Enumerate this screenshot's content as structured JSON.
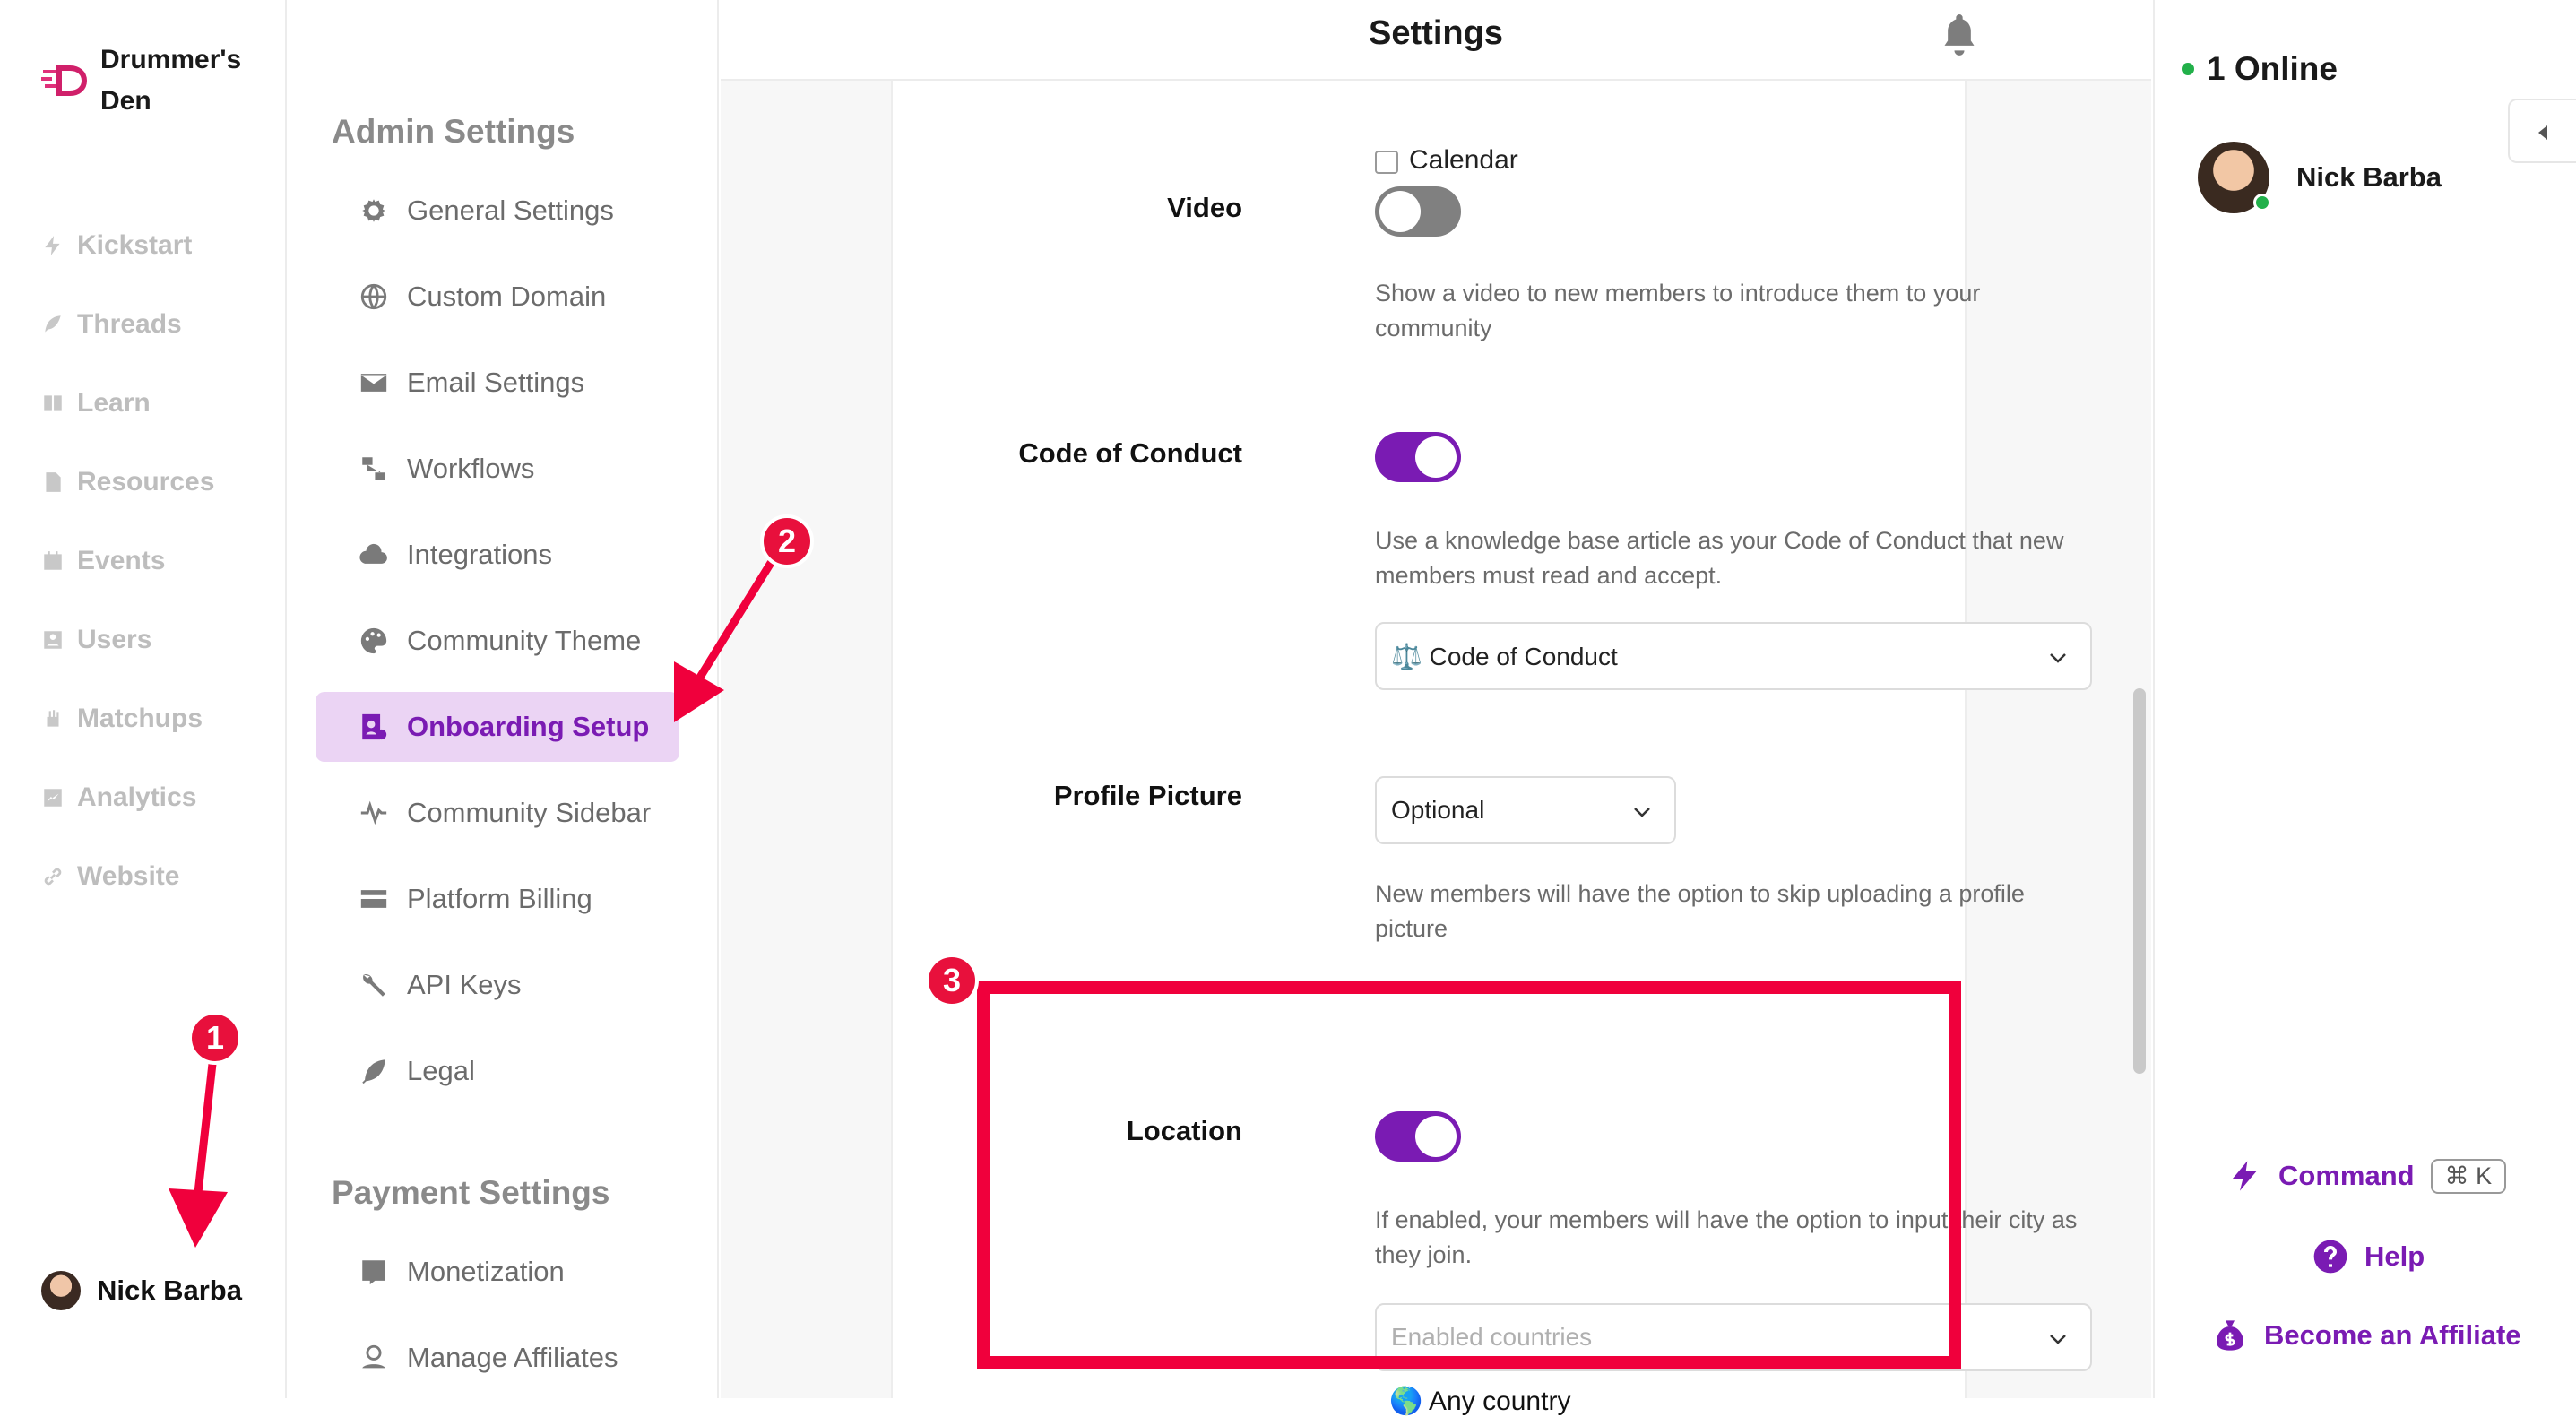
{
  "brand": {
    "name": "Drummer's Den"
  },
  "left_nav": {
    "items": [
      "Kickstart",
      "Threads",
      "Learn",
      "Resources",
      "Events",
      "Users",
      "Matchups",
      "Analytics",
      "Website"
    ],
    "user": "Nick Barba"
  },
  "settings_nav": {
    "admin_title": "Admin Settings",
    "admin_items": [
      "General Settings",
      "Custom Domain",
      "Email Settings",
      "Workflows",
      "Integrations",
      "Community Theme",
      "Onboarding Setup",
      "Community Sidebar",
      "Platform Billing",
      "API Keys",
      "Legal"
    ],
    "active_item": "Onboarding Setup",
    "payment_title": "Payment Settings",
    "payment_items": [
      "Monetization",
      "Manage Affiliates"
    ]
  },
  "header": {
    "title": "Settings",
    "icon": "bell-icon"
  },
  "form": {
    "calendar_peek": "Calendar",
    "video": {
      "label": "Video",
      "enabled": false,
      "description": "Show a video to new members to introduce them to your community"
    },
    "code_of_conduct": {
      "label": "Code of Conduct",
      "enabled": true,
      "description": "Use a knowledge base article as your Code of Conduct that new members must read and accept.",
      "selected": "⚖️ Code of Conduct"
    },
    "profile_picture": {
      "label": "Profile Picture",
      "selected": "Optional",
      "description": "New members will have the option to skip uploading a profile picture"
    },
    "location": {
      "label": "Location",
      "enabled": true,
      "description": "If enabled, your members will have the option to input their city as they join.",
      "placeholder": "Enabled countries",
      "tag": "🌎 Any country"
    }
  },
  "right_panel": {
    "online": "1 Online",
    "member": "Nick Barba",
    "command_label": "Command",
    "command_shortcut": "⌘ K",
    "help_label": "Help",
    "affiliate_label": "Become an Affiliate"
  },
  "annotations": {
    "badges": [
      "1",
      "2",
      "3"
    ],
    "accent": "#f0003c"
  },
  "colors": {
    "accent": "#7a1bb3",
    "active_bg": "#ebd4f4",
    "online": "#22b04a"
  }
}
